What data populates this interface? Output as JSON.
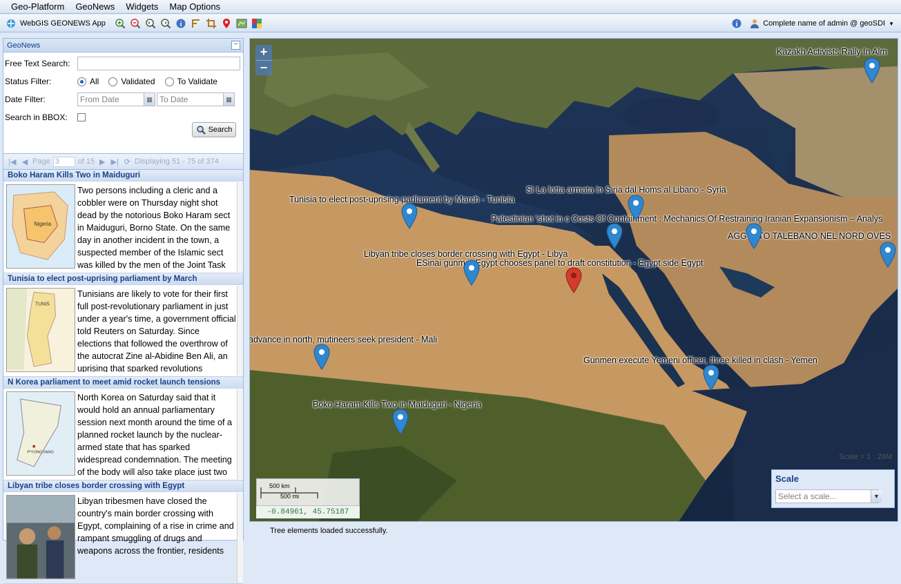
{
  "menu": [
    "Geo-Platform",
    "GeoNews",
    "Widgets",
    "Map Options"
  ],
  "toolbar": {
    "app_label": "WebGIS GEONEWS App",
    "user_label": "Complete name of admin @ geoSDI"
  },
  "panel": {
    "title": "GeoNews",
    "free_text_label": "Free Text Search:",
    "status_label": "Status Filter:",
    "status_options": [
      "All",
      "Validated",
      "To Validate"
    ],
    "date_label": "Date Filter:",
    "from_placeholder": "From Date",
    "to_placeholder": "To Date",
    "bbox_label": "Search in BBOX:",
    "search_button": "Search"
  },
  "pager": {
    "page_label": "Page",
    "page_value": "3",
    "of_label": "of 15",
    "displaying": "Displaying 51 - 75 of 374"
  },
  "news": [
    {
      "title": "Boko Haram Kills Two in Maiduguri",
      "text": "Two persons including a cleric and a cobbler were on Thursday night shot dead by the notorious Boko Haram sect in Maiduguri, Borno State. On the same day in another incident in the town, a suspected member of the Islamic sect was killed by the men of the Joint Task"
    },
    {
      "title": "Tunisia to elect post-uprising parliament by March",
      "text": "Tunisians are likely to vote for their first full post-revolutionary parliament in just under a year's time, a government official told Reuters on Saturday. Since elections that followed the overthrow of the autocrat Zine al-Abidine Ben Ali, an uprising that sparked revolutions"
    },
    {
      "title": "N Korea parliament to meet amid rocket launch tensions",
      "text": "North Korea on Saturday said that it would hold an annual parliamentary session next month around the time of a planned rocket launch by the nuclear-armed state that has sparked widespread condemnation. The meeting of the body will also take place just two"
    },
    {
      "title": "Libyan tribe closes border crossing with Egypt",
      "text": "Libyan tribesmen have closed the country's main border crossing with Egypt, complaining of a rise in crime and rampant smuggling of drugs and weapons across the frontier, residents"
    }
  ],
  "map": {
    "labels": [
      "Kazakh Activists Rally In Alm",
      "Si La lotta armata in Siria dal Homs al Libano - Syria",
      "Tunisia to elect post-uprising parliament by March - Tunisia",
      "Palestinian 'shot in c Costs Of Containment : Mechanics Of Restraining Iranian Expansionism – Analys",
      "AGGUATO TALEBANO NEL NORD OVES",
      "Libyan tribe closes border crossing with Egypt - Libya",
      "ESinai gunmer Egypt chooses panel to draft constitution - Egypt side Egypt",
      "advance in north, mutineers seek president - Mali",
      "Gunmen execute Yemeni officer, three killed in clash - Yemen",
      "Boko Haram Kills Two in Maiduguri - Nigeria"
    ],
    "scale_km": "500 km",
    "scale_mi": "500 mi",
    "coords": "-0.84961, 45.75187",
    "scale_text": "Scale = 1 : 28M",
    "scale_title": "Scale",
    "scale_placeholder": "Select a scale..."
  },
  "status": "Tree elements loaded successfully."
}
